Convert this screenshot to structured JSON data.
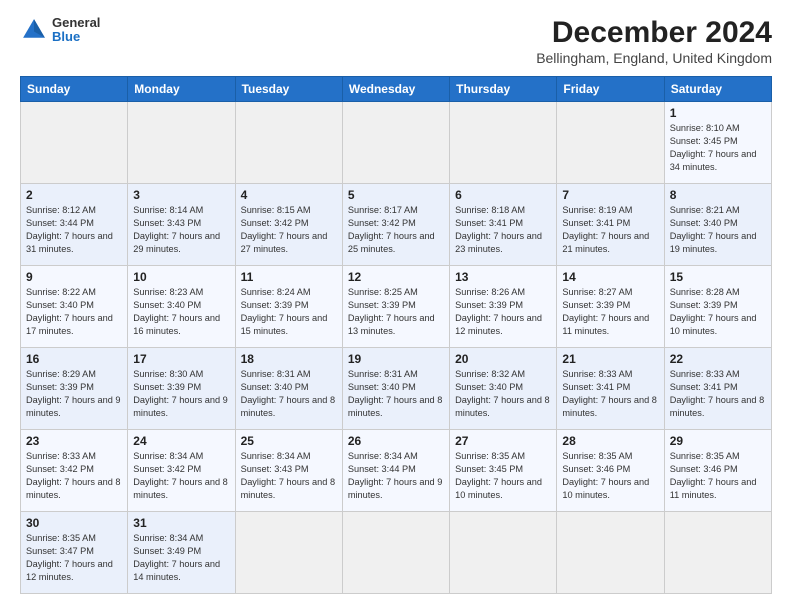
{
  "header": {
    "logo": {
      "general": "General",
      "blue": "Blue"
    },
    "title": "December 2024",
    "subtitle": "Bellingham, England, United Kingdom"
  },
  "calendar": {
    "weekdays": [
      "Sunday",
      "Monday",
      "Tuesday",
      "Wednesday",
      "Thursday",
      "Friday",
      "Saturday"
    ],
    "weeks": [
      [
        null,
        null,
        null,
        null,
        null,
        null,
        {
          "day": "1",
          "sunrise": "Sunrise: 8:10 AM",
          "sunset": "Sunset: 3:45 PM",
          "daylight": "Daylight: 7 hours and 34 minutes."
        }
      ],
      [
        {
          "day": "2",
          "sunrise": "Sunrise: 8:12 AM",
          "sunset": "Sunset: 3:44 PM",
          "daylight": "Daylight: 7 hours and 31 minutes."
        },
        {
          "day": "3",
          "sunrise": "Sunrise: 8:14 AM",
          "sunset": "Sunset: 3:43 PM",
          "daylight": "Daylight: 7 hours and 29 minutes."
        },
        {
          "day": "4",
          "sunrise": "Sunrise: 8:15 AM",
          "sunset": "Sunset: 3:42 PM",
          "daylight": "Daylight: 7 hours and 27 minutes."
        },
        {
          "day": "5",
          "sunrise": "Sunrise: 8:17 AM",
          "sunset": "Sunset: 3:42 PM",
          "daylight": "Daylight: 7 hours and 25 minutes."
        },
        {
          "day": "6",
          "sunrise": "Sunrise: 8:18 AM",
          "sunset": "Sunset: 3:41 PM",
          "daylight": "Daylight: 7 hours and 23 minutes."
        },
        {
          "day": "7",
          "sunrise": "Sunrise: 8:19 AM",
          "sunset": "Sunset: 3:41 PM",
          "daylight": "Daylight: 7 hours and 21 minutes."
        },
        {
          "day": "8",
          "sunrise": "Sunrise: 8:21 AM",
          "sunset": "Sunset: 3:40 PM",
          "daylight": "Daylight: 7 hours and 19 minutes."
        }
      ],
      [
        {
          "day": "9",
          "sunrise": "Sunrise: 8:22 AM",
          "sunset": "Sunset: 3:40 PM",
          "daylight": "Daylight: 7 hours and 17 minutes."
        },
        {
          "day": "10",
          "sunrise": "Sunrise: 8:23 AM",
          "sunset": "Sunset: 3:40 PM",
          "daylight": "Daylight: 7 hours and 16 minutes."
        },
        {
          "day": "11",
          "sunrise": "Sunrise: 8:24 AM",
          "sunset": "Sunset: 3:39 PM",
          "daylight": "Daylight: 7 hours and 15 minutes."
        },
        {
          "day": "12",
          "sunrise": "Sunrise: 8:25 AM",
          "sunset": "Sunset: 3:39 PM",
          "daylight": "Daylight: 7 hours and 13 minutes."
        },
        {
          "day": "13",
          "sunrise": "Sunrise: 8:26 AM",
          "sunset": "Sunset: 3:39 PM",
          "daylight": "Daylight: 7 hours and 12 minutes."
        },
        {
          "day": "14",
          "sunrise": "Sunrise: 8:27 AM",
          "sunset": "Sunset: 3:39 PM",
          "daylight": "Daylight: 7 hours and 11 minutes."
        },
        {
          "day": "15",
          "sunrise": "Sunrise: 8:28 AM",
          "sunset": "Sunset: 3:39 PM",
          "daylight": "Daylight: 7 hours and 10 minutes."
        }
      ],
      [
        {
          "day": "16",
          "sunrise": "Sunrise: 8:29 AM",
          "sunset": "Sunset: 3:39 PM",
          "daylight": "Daylight: 7 hours and 9 minutes."
        },
        {
          "day": "17",
          "sunrise": "Sunrise: 8:30 AM",
          "sunset": "Sunset: 3:39 PM",
          "daylight": "Daylight: 7 hours and 9 minutes."
        },
        {
          "day": "18",
          "sunrise": "Sunrise: 8:31 AM",
          "sunset": "Sunset: 3:40 PM",
          "daylight": "Daylight: 7 hours and 8 minutes."
        },
        {
          "day": "19",
          "sunrise": "Sunrise: 8:31 AM",
          "sunset": "Sunset: 3:40 PM",
          "daylight": "Daylight: 7 hours and 8 minutes."
        },
        {
          "day": "20",
          "sunrise": "Sunrise: 8:32 AM",
          "sunset": "Sunset: 3:40 PM",
          "daylight": "Daylight: 7 hours and 8 minutes."
        },
        {
          "day": "21",
          "sunrise": "Sunrise: 8:33 AM",
          "sunset": "Sunset: 3:41 PM",
          "daylight": "Daylight: 7 hours and 8 minutes."
        },
        {
          "day": "22",
          "sunrise": "Sunrise: 8:33 AM",
          "sunset": "Sunset: 3:41 PM",
          "daylight": "Daylight: 7 hours and 8 minutes."
        }
      ],
      [
        {
          "day": "23",
          "sunrise": "Sunrise: 8:33 AM",
          "sunset": "Sunset: 3:42 PM",
          "daylight": "Daylight: 7 hours and 8 minutes."
        },
        {
          "day": "24",
          "sunrise": "Sunrise: 8:34 AM",
          "sunset": "Sunset: 3:42 PM",
          "daylight": "Daylight: 7 hours and 8 minutes."
        },
        {
          "day": "25",
          "sunrise": "Sunrise: 8:34 AM",
          "sunset": "Sunset: 3:43 PM",
          "daylight": "Daylight: 7 hours and 8 minutes."
        },
        {
          "day": "26",
          "sunrise": "Sunrise: 8:34 AM",
          "sunset": "Sunset: 3:44 PM",
          "daylight": "Daylight: 7 hours and 9 minutes."
        },
        {
          "day": "27",
          "sunrise": "Sunrise: 8:35 AM",
          "sunset": "Sunset: 3:45 PM",
          "daylight": "Daylight: 7 hours and 10 minutes."
        },
        {
          "day": "28",
          "sunrise": "Sunrise: 8:35 AM",
          "sunset": "Sunset: 3:46 PM",
          "daylight": "Daylight: 7 hours and 10 minutes."
        },
        {
          "day": "29",
          "sunrise": "Sunrise: 8:35 AM",
          "sunset": "Sunset: 3:46 PM",
          "daylight": "Daylight: 7 hours and 11 minutes."
        }
      ],
      [
        {
          "day": "30",
          "sunrise": "Sunrise: 8:35 AM",
          "sunset": "Sunset: 3:47 PM",
          "daylight": "Daylight: 7 hours and 12 minutes."
        },
        {
          "day": "31",
          "sunrise": "Sunrise: 8:34 AM",
          "sunset": "Sunset: 3:49 PM",
          "daylight": "Daylight: 7 hours and 14 minutes."
        },
        null,
        null,
        null,
        null,
        null
      ]
    ]
  }
}
